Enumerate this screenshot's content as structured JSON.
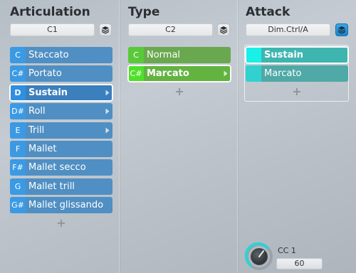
{
  "articulation": {
    "title": "Articulation",
    "selector_value": "C1",
    "add_symbol": "+",
    "items": [
      {
        "key": "C",
        "label": "Staccato",
        "arrow": false,
        "selected": false
      },
      {
        "key": "C#",
        "label": "Portato",
        "arrow": false,
        "selected": false
      },
      {
        "key": "D",
        "label": "Sustain",
        "arrow": true,
        "selected": true
      },
      {
        "key": "D#",
        "label": "Roll",
        "arrow": true,
        "selected": false
      },
      {
        "key": "E",
        "label": "Trill",
        "arrow": true,
        "selected": false
      },
      {
        "key": "F",
        "label": "Mallet",
        "arrow": false,
        "selected": false
      },
      {
        "key": "F#",
        "label": "Mallet secco",
        "arrow": false,
        "selected": false
      },
      {
        "key": "G",
        "label": "Mallet trill",
        "arrow": false,
        "selected": false
      },
      {
        "key": "G#",
        "label": "Mallet glissando",
        "arrow": false,
        "selected": false
      }
    ]
  },
  "type": {
    "title": "Type",
    "selector_value": "C2",
    "add_symbol": "+",
    "items": [
      {
        "key": "C",
        "label": "Normal",
        "arrow": false,
        "selected": false
      },
      {
        "key": "C#",
        "label": "Marcato",
        "arrow": true,
        "selected": true
      }
    ]
  },
  "attack": {
    "title": "Attack",
    "selector_value": "Dim.Ctrl/A",
    "add_symbol": "+",
    "items": [
      {
        "key": "",
        "label": "Sustain",
        "arrow": false,
        "selected": true
      },
      {
        "key": "",
        "label": "Marcato",
        "arrow": false,
        "selected": false
      }
    ]
  },
  "cc": {
    "label": "CC 1",
    "value": "60"
  },
  "icons": {
    "layers": "layers-icon",
    "arrow": "chevron-right-icon",
    "knob": "knob-icon"
  },
  "colors": {
    "articulation_item": "#4f8fc3",
    "articulation_key": "#3b9ae3",
    "type_item": "#6aa84f",
    "type_key": "#59c93a",
    "attack_item": "#4fa9a6",
    "attack_key": "#30d1cf",
    "knob_ring": "#2fd1d6"
  }
}
